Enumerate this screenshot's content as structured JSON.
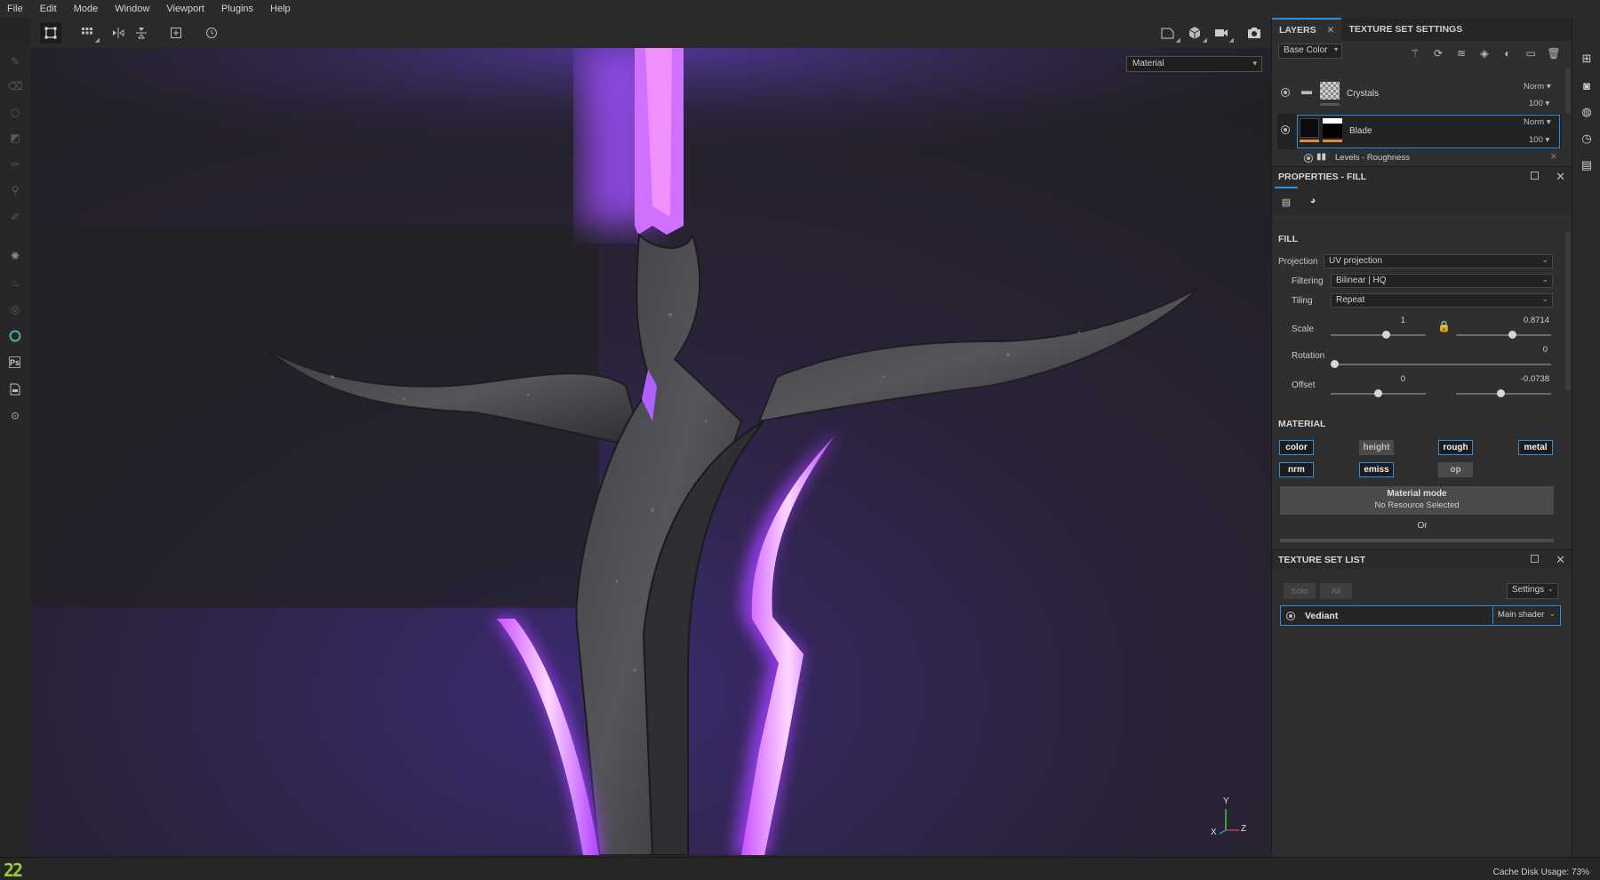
{
  "menu": [
    "File",
    "Edit",
    "Mode",
    "Window",
    "Viewport",
    "Plugins",
    "Help"
  ],
  "viewport": {
    "mode_select": "Material",
    "axes": {
      "x": "X",
      "y": "Y",
      "z": "Z"
    }
  },
  "layers_panel": {
    "tabs": [
      {
        "label": "LAYERS",
        "close": "✕"
      },
      {
        "label": "TEXTURE SET SETTINGS"
      }
    ],
    "channel_select": "Base Color",
    "layers": [
      {
        "name": "Crystals",
        "blend_mode": "Norm",
        "opacity": "100"
      },
      {
        "name": "Blade",
        "blend_mode": "Norm",
        "opacity": "100"
      }
    ],
    "effect": {
      "name": "Levels - Roughness"
    }
  },
  "properties": {
    "title": "PROPERTIES - FILL",
    "fill_section": "FILL",
    "projection_label": "Projection",
    "projection_value": "UV projection",
    "filtering_label": "Filtering",
    "filtering_value": "Bilinear | HQ",
    "tiling_label": "Tiling",
    "tiling_value": "Repeat",
    "scale_label": "Scale",
    "scale_u": "1",
    "scale_v": "0.8714",
    "rotation_label": "Rotation",
    "rotation_value": "0",
    "offset_label": "Offset",
    "offset_u": "0",
    "offset_v": "-0.0738",
    "material_section": "MATERIAL",
    "channels": [
      {
        "label": "color",
        "active": true
      },
      {
        "label": "height",
        "active": false
      },
      {
        "label": "rough",
        "active": true
      },
      {
        "label": "metal",
        "active": true
      },
      {
        "label": "nrm",
        "active": true
      },
      {
        "label": "emiss",
        "active": true
      },
      {
        "label": "op",
        "active": false
      }
    ],
    "material_mode_title": "Material mode",
    "material_mode_value": "No Resource Selected",
    "or_label": "Or"
  },
  "texture_set_list": {
    "title": "TEXTURE SET LIST",
    "solo_label": "Solo",
    "all_label": "All",
    "settings_label": "Settings",
    "sets": [
      {
        "name": "Vediant",
        "shader": "Main shader"
      }
    ]
  },
  "status": {
    "logo": "22",
    "cache_label": "Cache Disk Usage:",
    "cache_value": "73%"
  }
}
